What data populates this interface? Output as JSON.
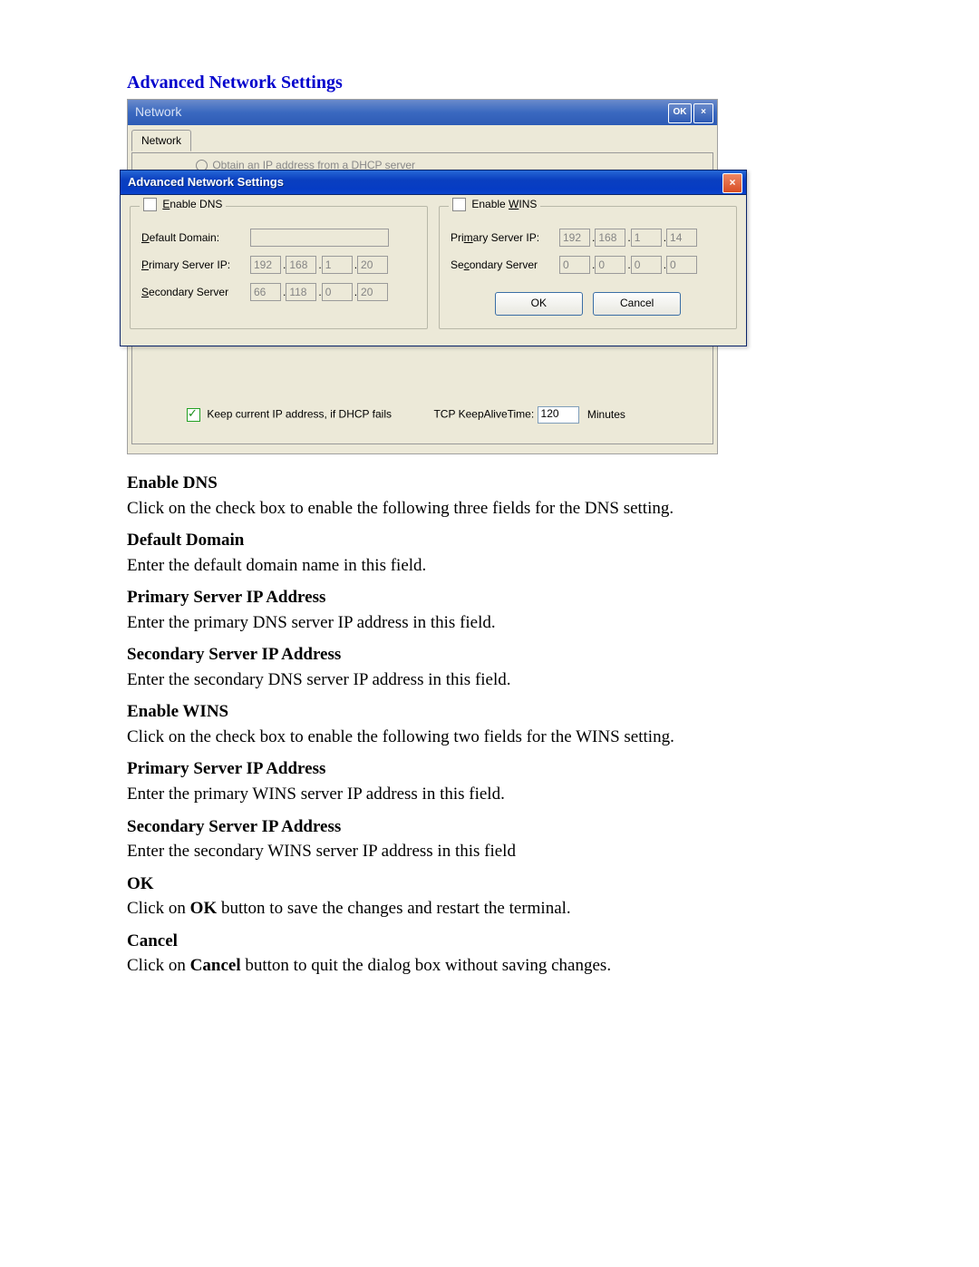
{
  "section_title": "Advanced Network Settings",
  "parent_window": {
    "title": "Network",
    "ok_btn": "OK",
    "close_btn": "×",
    "tab_label": "Network",
    "radio_label": "Obtain an IP address from a DHCP server",
    "dhcp_keep_label": "Keep current IP address, if DHCP fails",
    "keepalive_label": "TCP KeepAliveTime:",
    "keepalive_value": "120",
    "keepalive_unit": "Minutes"
  },
  "dialog": {
    "title": "Advanced Network Settings",
    "close_btn": "×",
    "dns": {
      "legend_check_label": "Enable DNS",
      "default_domain_label": "Default Domain:",
      "default_domain_value": "",
      "primary_label": "Primary Server IP:",
      "primary_ip": [
        "192",
        "168",
        "1",
        "20"
      ],
      "secondary_label": "Secondary Server",
      "secondary_ip": [
        "66",
        "118",
        "0",
        "20"
      ]
    },
    "wins": {
      "legend_check_label": "Enable WINS",
      "primary_label": "Primary Server IP:",
      "primary_ip": [
        "192",
        "168",
        "1",
        "14"
      ],
      "secondary_label": "Secondary Server",
      "secondary_ip": [
        "0",
        "0",
        "0",
        "0"
      ]
    },
    "ok_btn": "OK",
    "cancel_btn": "Cancel"
  },
  "descriptions": [
    {
      "head": "Enable DNS",
      "body": "Click on the check box to enable the following three fields for the DNS setting."
    },
    {
      "head": "Default Domain",
      "body": "Enter the default domain name in this field."
    },
    {
      "head": "Primary Server IP Address",
      "body": "Enter the primary DNS server IP address in this field."
    },
    {
      "head": "Secondary Server IP Address",
      "body": "Enter the secondary DNS server IP address in this field."
    },
    {
      "head": "Enable WINS",
      "body": "Click on the check box to enable the following two fields for the WINS setting."
    },
    {
      "head": "Primary Server IP Address",
      "body": "Enter the primary WINS server IP address in this field."
    },
    {
      "head": "Secondary Server IP Address",
      "body": "Enter the secondary WINS server IP address in this field"
    },
    {
      "head": "OK",
      "body_pre": "Click on ",
      "body_bold": "OK",
      "body_post": " button to save the changes and restart the terminal."
    },
    {
      "head": "Cancel",
      "body_pre": "Click on ",
      "body_bold": "Cancel",
      "body_post": " button to quit the dialog box without saving changes."
    }
  ]
}
